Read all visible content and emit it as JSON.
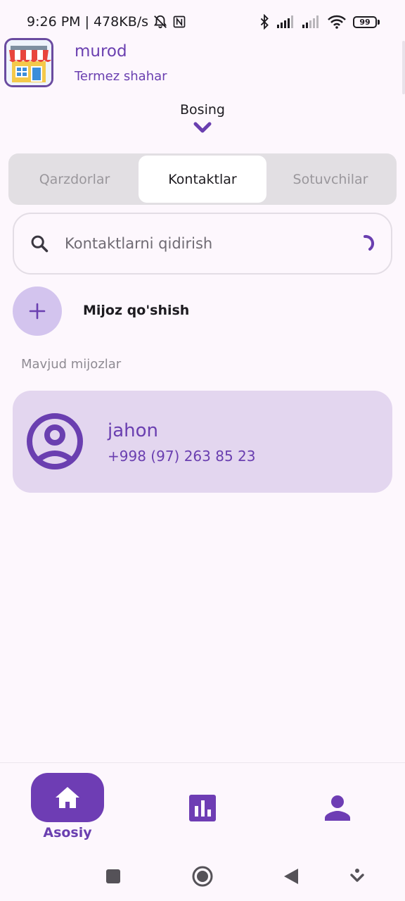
{
  "status_bar": {
    "time": "9:26 PM",
    "net_speed": "478KB/s",
    "battery": "99",
    "icons": [
      "bell-off-icon",
      "nfc-icon",
      "bluetooth-icon",
      "signal-icon",
      "signal-icon",
      "wifi-icon",
      "battery-icon"
    ]
  },
  "header": {
    "store_name": "murod",
    "city": "Termez shahar",
    "toggle_label": "Bosing"
  },
  "tabs": [
    {
      "label": "Qarzdorlar",
      "active": false
    },
    {
      "label": "Kontaktlar",
      "active": true
    },
    {
      "label": "Sotuvchilar",
      "active": false
    }
  ],
  "search": {
    "placeholder": "Kontaktlarni qidirish",
    "value": ""
  },
  "add_client": {
    "label": "Mijoz qo'shish"
  },
  "section": {
    "title": "Mavjud mijozlar"
  },
  "contacts": [
    {
      "name": "jahon",
      "phone": "+998 (97) 263 85 23"
    }
  ],
  "bottom_nav": {
    "items": [
      {
        "label": "Asosiy",
        "icon": "home-icon",
        "active": true
      },
      {
        "label": "",
        "icon": "bar-chart-icon",
        "active": false
      },
      {
        "label": "",
        "icon": "person-icon",
        "active": false
      }
    ]
  },
  "colors": {
    "accent": "#6e3db4",
    "accent_text": "#6a3fb0",
    "card_bg": "#e3d6ef",
    "background": "#fdf7fd"
  }
}
